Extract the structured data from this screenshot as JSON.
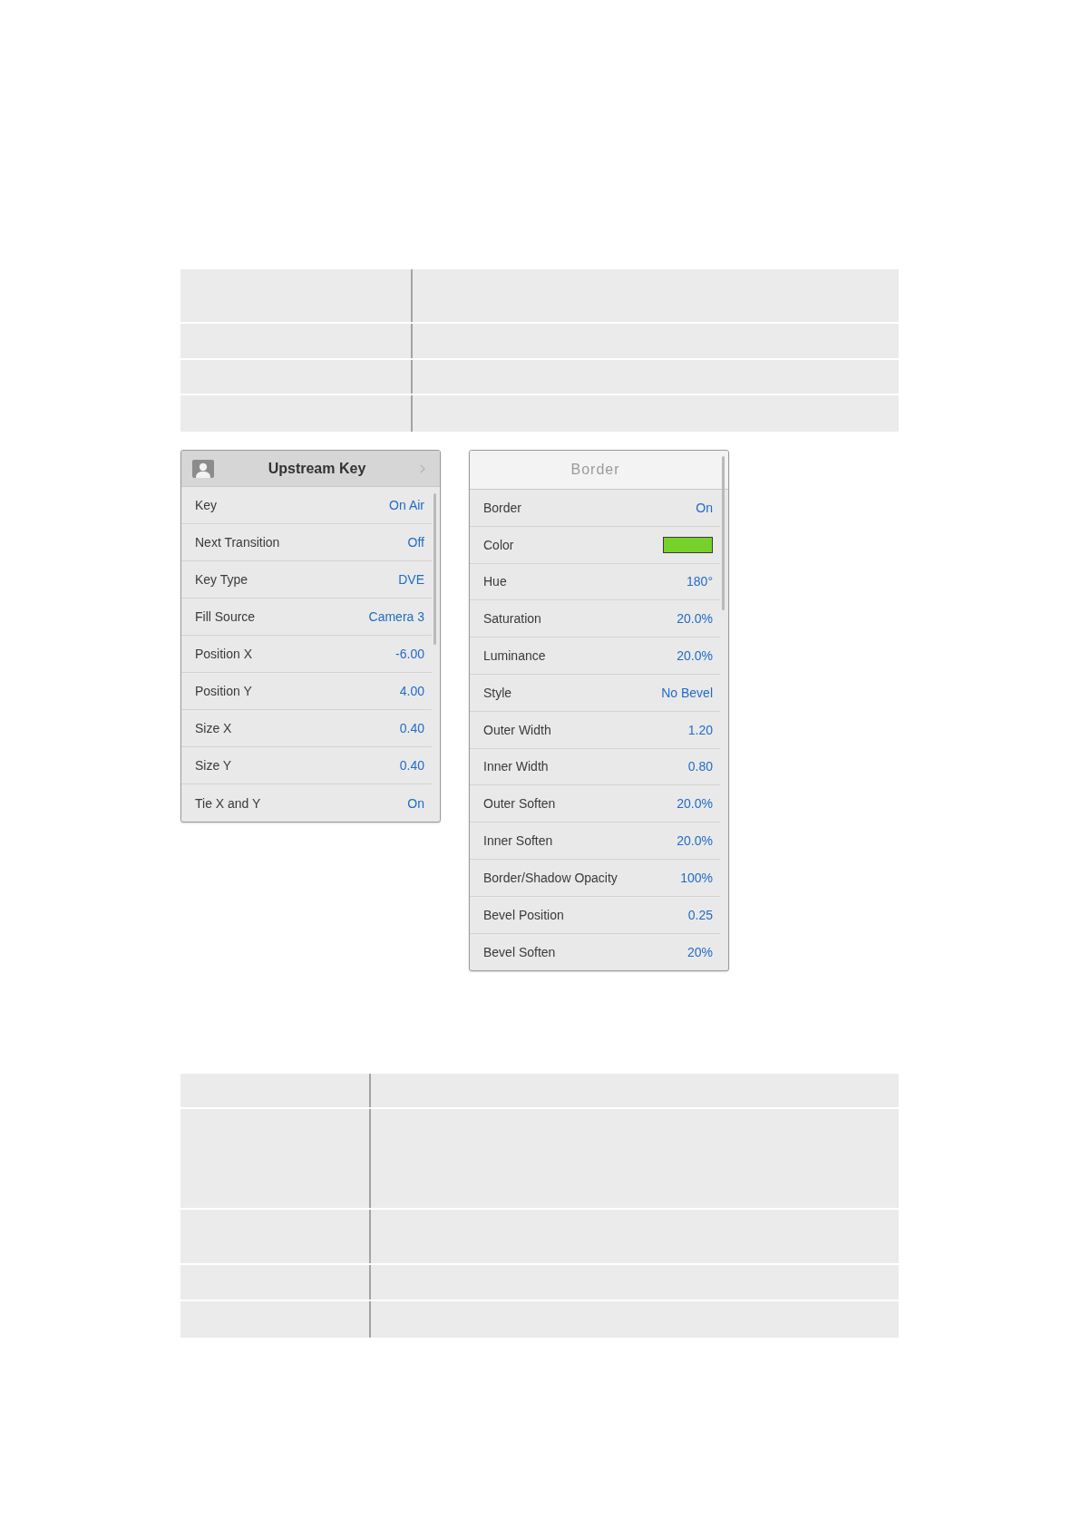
{
  "panels": [
    {
      "kind": "source",
      "title": "Upstream Key",
      "rows": [
        {
          "kind": "value",
          "label": "Key",
          "value": "On Air"
        },
        {
          "kind": "value",
          "label": "Next Transition",
          "value": "Off"
        },
        {
          "kind": "value",
          "label": "Key Type",
          "value": "DVE"
        },
        {
          "kind": "value",
          "label": "Fill Source",
          "value": "Camera 3"
        },
        {
          "kind": "value",
          "label": "Position X",
          "value": "-6.00"
        },
        {
          "kind": "value",
          "label": "Position Y",
          "value": "4.00"
        },
        {
          "kind": "value",
          "label": "Size X",
          "value": "0.40"
        },
        {
          "kind": "value",
          "label": "Size Y",
          "value": "0.40"
        },
        {
          "kind": "value",
          "label": "Tie X and Y",
          "value": "On"
        }
      ]
    },
    {
      "kind": "plain",
      "title": "Border",
      "rows": [
        {
          "kind": "value",
          "label": "Border",
          "value": "On"
        },
        {
          "kind": "swatch",
          "label": "Color",
          "color": "#77d12b"
        },
        {
          "kind": "value",
          "label": "Hue",
          "value": "180°"
        },
        {
          "kind": "value",
          "label": "Saturation",
          "value": "20.0%"
        },
        {
          "kind": "value",
          "label": "Luminance",
          "value": "20.0%"
        },
        {
          "kind": "value",
          "label": "Style",
          "value": "No Bevel"
        },
        {
          "kind": "value",
          "label": "Outer Width",
          "value": "1.20"
        },
        {
          "kind": "value",
          "label": "Inner Width",
          "value": "0.80"
        },
        {
          "kind": "value",
          "label": "Outer Soften",
          "value": "20.0%"
        },
        {
          "kind": "value",
          "label": "Inner Soften",
          "value": "20.0%"
        },
        {
          "kind": "value",
          "label": "Border/Shadow Opacity",
          "value": "100%"
        },
        {
          "kind": "value",
          "label": "Bevel Position",
          "value": "0.25"
        },
        {
          "kind": "value",
          "label": "Bevel Soften",
          "value": "20%"
        }
      ]
    }
  ]
}
